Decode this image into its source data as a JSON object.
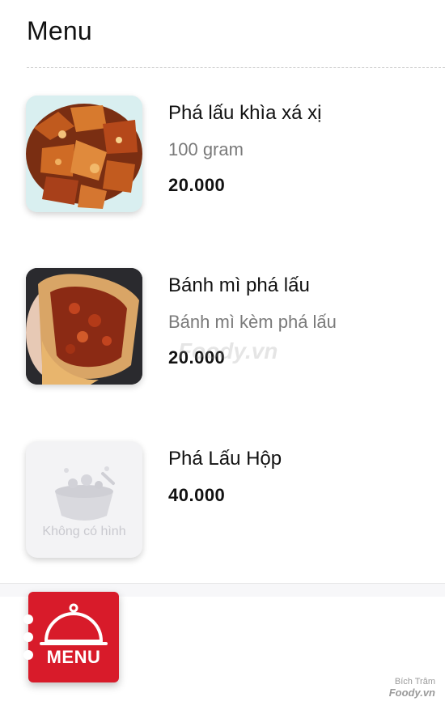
{
  "header": {
    "title": "Menu"
  },
  "items": [
    {
      "name": "Phá lấu khìa xá xị",
      "description": "100 gram",
      "price": "20.000",
      "image": "pha-lau-dish-photo"
    },
    {
      "name": "Bánh mì phá lấu",
      "description": "Bánh mì kèm phá lấu",
      "price": "20.000",
      "image": "banh-mi-photo"
    },
    {
      "name": "Phá Lấu Hộp",
      "description": "",
      "price": "40.000",
      "image": "no-image-placeholder",
      "placeholder_text": "Không có hình"
    }
  ],
  "watermark": "Foody.vn",
  "fab": {
    "label": "MENU",
    "icon": "cloche-icon",
    "color": "#d81b2a"
  },
  "credit": {
    "author": "Bích Trâm",
    "brand": "Foody.vn"
  }
}
